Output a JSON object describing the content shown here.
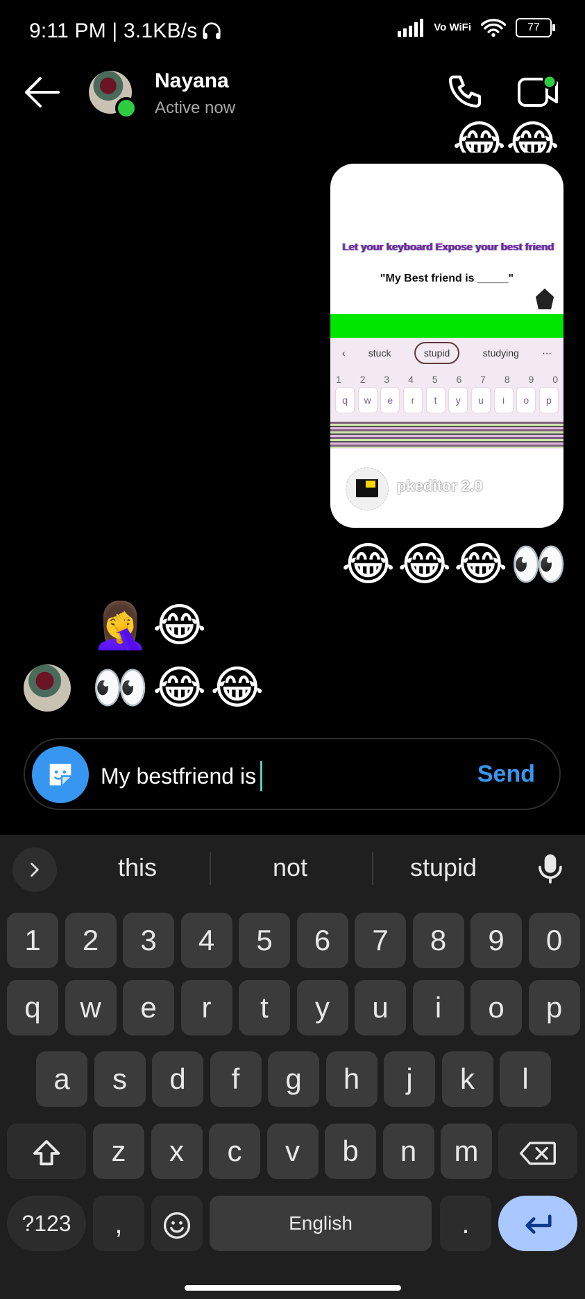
{
  "status_bar": {
    "time_speed": "9:11 PM | 3.1KB/s",
    "vowifi": "Vo WiFi",
    "battery": "77"
  },
  "header": {
    "contact_name": "Nayana",
    "contact_status": "Active now"
  },
  "story_card": {
    "headline": "Let your keyboard Expose your best friend",
    "quote": "\"My Best friend is _____\"",
    "suggestions": [
      "stuck",
      "stupid",
      "studying"
    ],
    "number_row": [
      "1",
      "2",
      "3",
      "4",
      "5",
      "6",
      "7",
      "8",
      "9",
      "0"
    ],
    "letter_row": [
      "q",
      "w",
      "e",
      "r",
      "t",
      "y",
      "u",
      "i",
      "o",
      "p"
    ],
    "footer_text": "pkeditor 2.0"
  },
  "messages": {
    "sent_reaction": "😂😂😂👀",
    "received_1": "🤦‍♀️😂",
    "received_2": "👀😂😂",
    "top_partial": "😂😂"
  },
  "composer": {
    "text": "My bestfriend is",
    "send_label": "Send"
  },
  "keyboard": {
    "suggestions": [
      "this",
      "not",
      "stupid"
    ],
    "row_numbers": [
      "1",
      "2",
      "3",
      "4",
      "5",
      "6",
      "7",
      "8",
      "9",
      "0"
    ],
    "row_1": [
      "q",
      "w",
      "e",
      "r",
      "t",
      "y",
      "u",
      "i",
      "o",
      "p"
    ],
    "row_2": [
      "a",
      "s",
      "d",
      "f",
      "g",
      "h",
      "j",
      "k",
      "l"
    ],
    "row_3": [
      "z",
      "x",
      "c",
      "v",
      "b",
      "n",
      "m"
    ],
    "symbols_label": "?123",
    "comma_label": ",",
    "space_label": "English",
    "period_label": "."
  },
  "icons": {
    "back": "back-arrow-icon",
    "phone": "phone-icon",
    "video": "video-call-icon",
    "sticker": "sticker-icon",
    "mic": "microphone-icon",
    "shift": "shift-icon",
    "backspace": "backspace-icon",
    "enter": "enter-icon",
    "emoji": "emoji-icon"
  },
  "colors": {
    "accent": "#3797f0",
    "online": "#2ecc40",
    "enter_key": "#a9c8ff"
  }
}
